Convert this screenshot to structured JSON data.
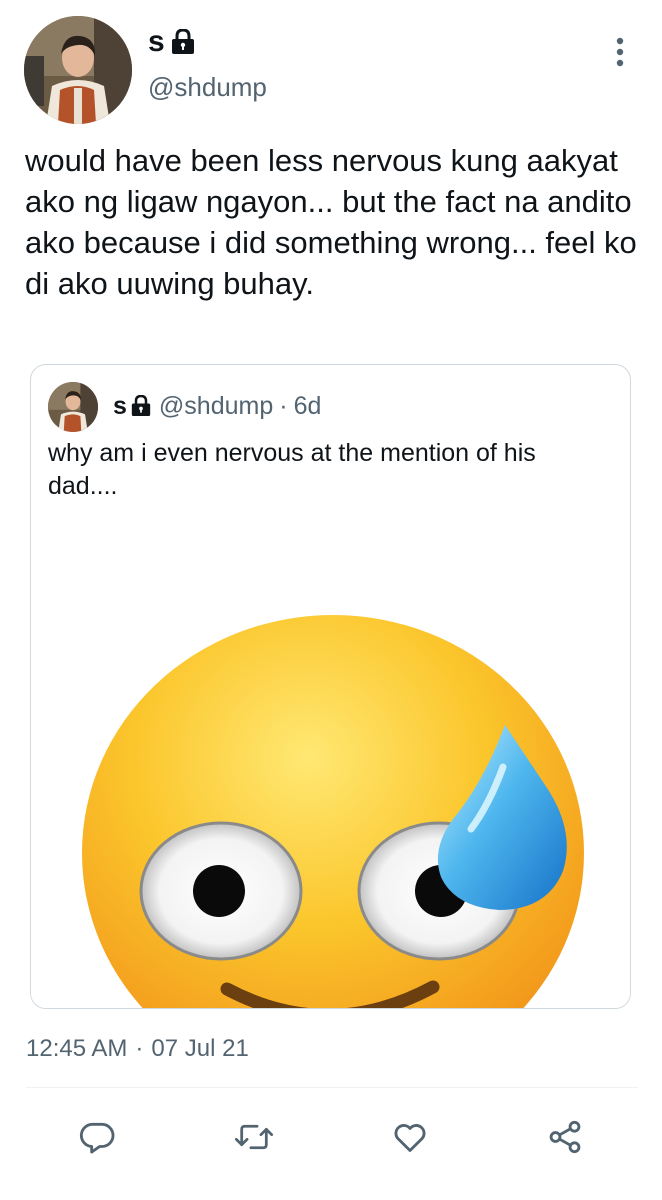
{
  "tweet": {
    "display_name": "s",
    "handle": "@shdump",
    "text": "would have been less nervous kung aakyat ako ng ligaw ngayon... but the fact na andito ako because i did something wrong... feel ko di ako uuwing buhay.",
    "time": "12:45 AM",
    "separator": "·",
    "date": "07 Jul 21"
  },
  "quoted_tweet": {
    "display_name": "s",
    "handle": "@shdump",
    "separator": "·",
    "relative_time": "6d",
    "text": "why am i even nervous at the mention of his dad....",
    "media_icon": "sweat-smile-emoji"
  },
  "icons": {
    "lock": "lock-icon",
    "more": "more-options-icon",
    "reply": "reply-icon",
    "retweet": "retweet-icon",
    "like": "heart-icon",
    "share": "share-icon"
  },
  "colors": {
    "text": "#0f1419",
    "secondary": "#536471",
    "border": "#cfd9de"
  }
}
